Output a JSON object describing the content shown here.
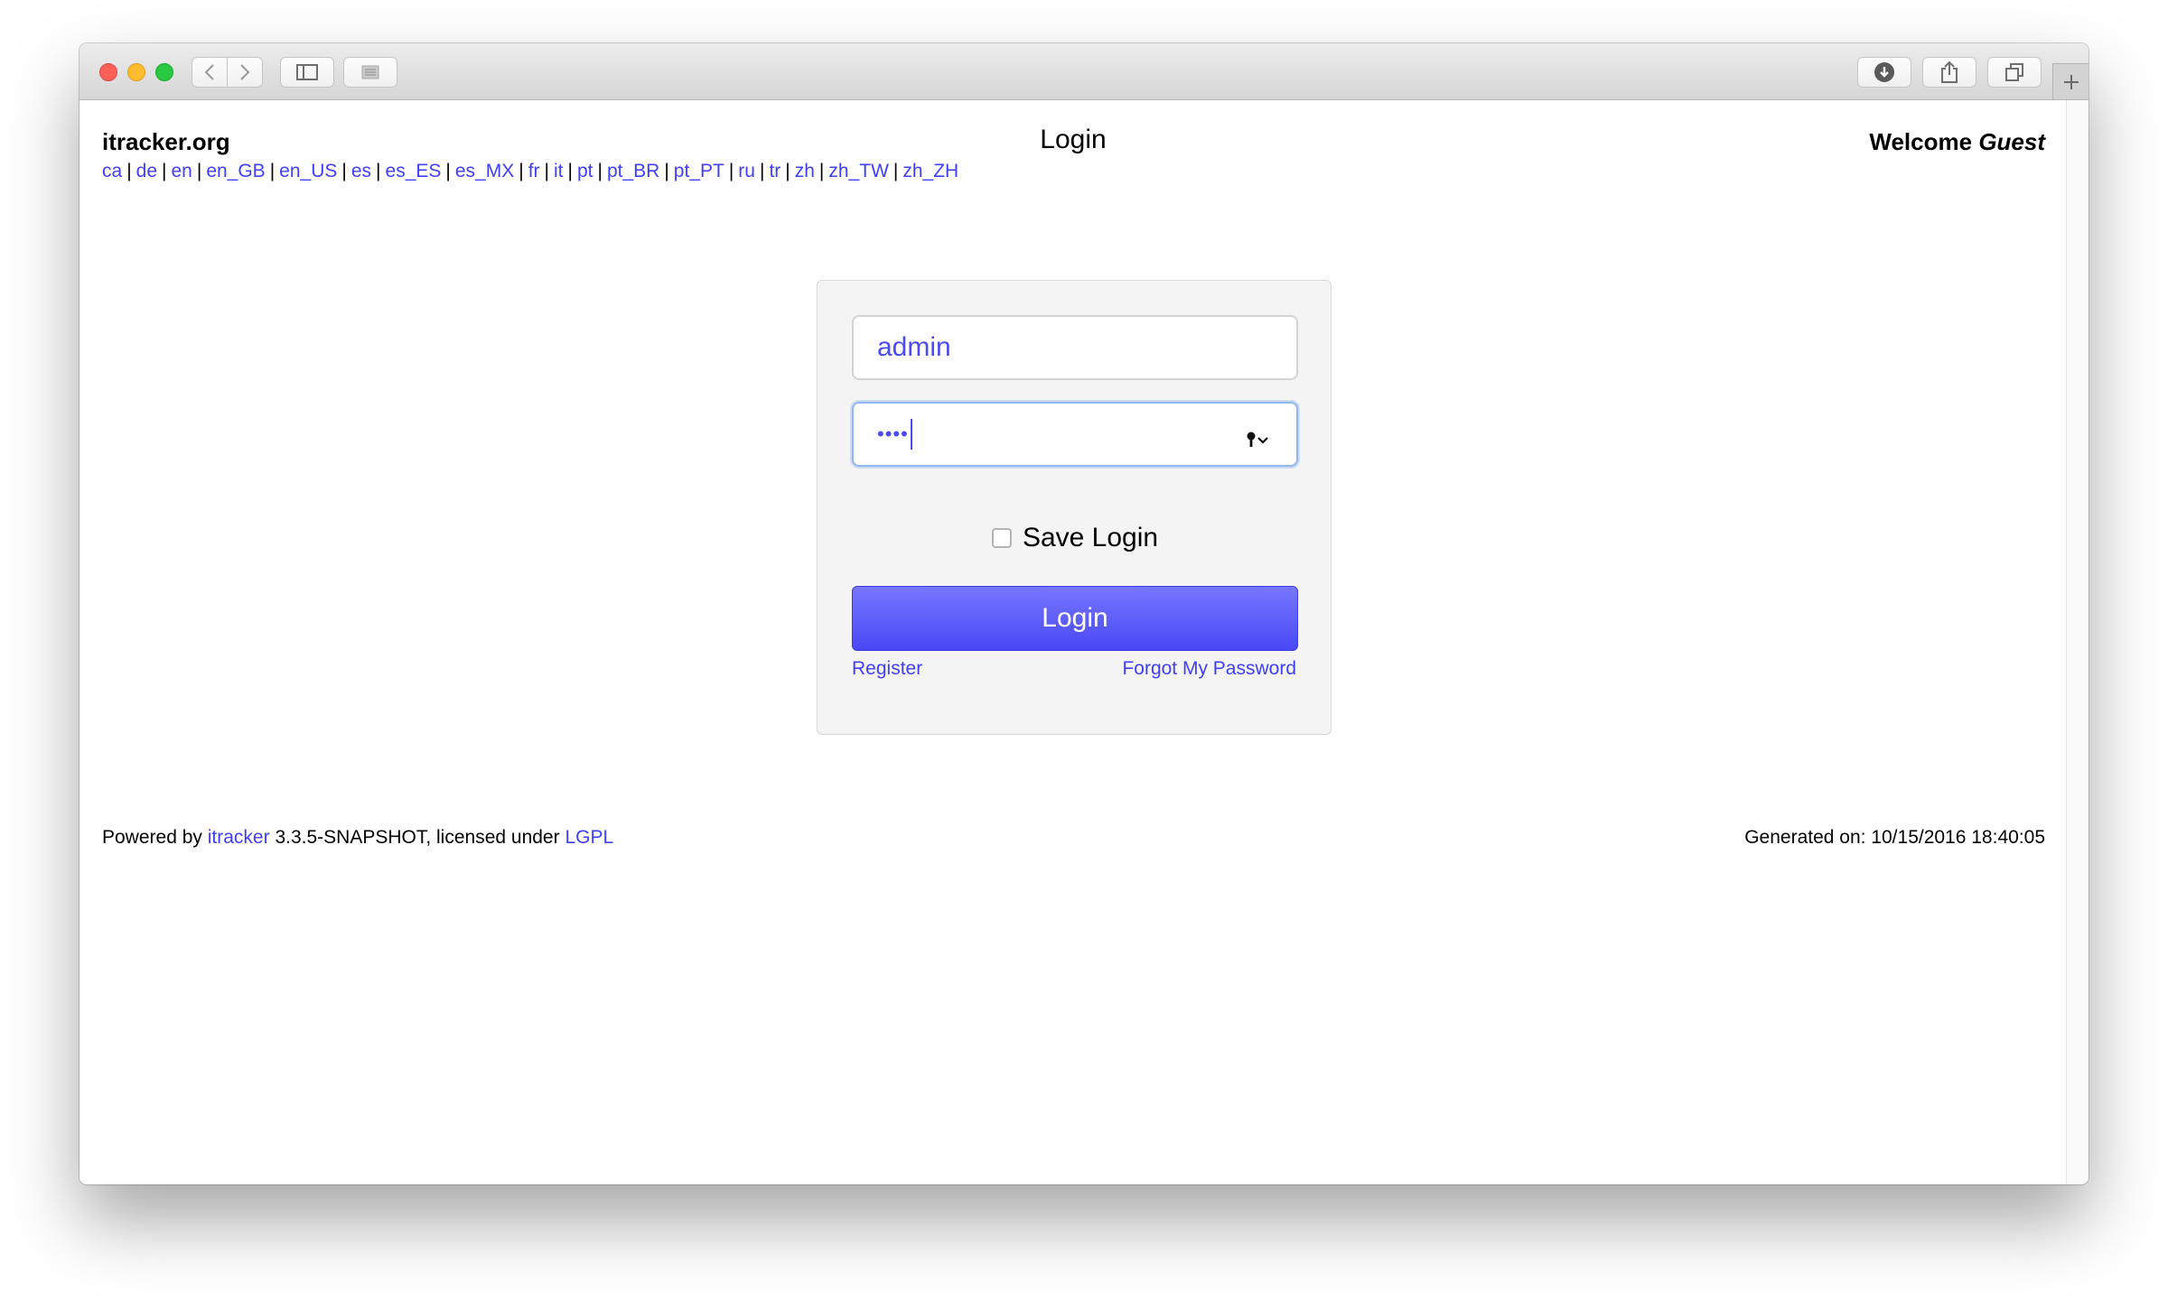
{
  "header": {
    "site_name": "itracker.org",
    "page_title": "Login",
    "welcome_prefix": "Welcome",
    "welcome_user": "Guest"
  },
  "languages": [
    "ca",
    "de",
    "en",
    "en_GB",
    "en_US",
    "es",
    "es_ES",
    "es_MX",
    "fr",
    "it",
    "pt",
    "pt_BR",
    "pt_PT",
    "ru",
    "tr",
    "zh",
    "zh_TW",
    "zh_ZH"
  ],
  "language_separator": "|",
  "login": {
    "username_value": "admin",
    "password_mask": "••••",
    "save_login_label": "Save Login",
    "save_login_checked": false,
    "button_label": "Login",
    "register_label": "Register",
    "forgot_label": "Forgot My Password"
  },
  "footer": {
    "powered_by": "Powered by",
    "itracker_link": "itracker",
    "version_text": "3.3.5-SNAPSHOT, licensed under",
    "license_link": "LGPL",
    "generated": "Generated on: 10/15/2016 18:40:05"
  },
  "colors": {
    "link": "#3f3ffa",
    "button": "#5a5af8",
    "input_text": "#4b4bf0"
  },
  "icons": {
    "back": "chevron-left-icon",
    "forward": "chevron-right-icon",
    "sidebar": "sidebar-icon",
    "reader": "reader-icon",
    "downloads": "download-icon",
    "share": "share-icon",
    "tabs": "tabs-overview-icon",
    "new_tab": "plus-icon",
    "password_keychain": "key-icon"
  }
}
